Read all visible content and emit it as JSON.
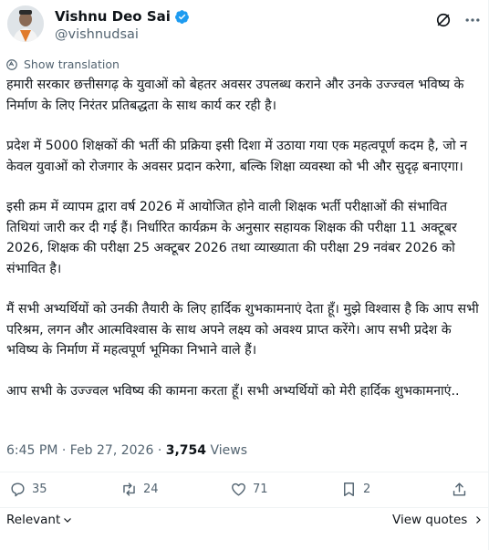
{
  "author": {
    "display_name": "Vishnu Deo Sai",
    "handle": "@vishnudsai",
    "verified_icon": "verified-badge-icon",
    "colors": {
      "verified": "#1d9bf0"
    }
  },
  "translation": {
    "label": "Show translation"
  },
  "post": {
    "paragraphs": [
      "हमारी सरकार छत्तीसगढ़ के युवाओं को बेहतर अवसर उपलब्ध कराने और उनके उज्ज्वल भविष्य के निर्माण के लिए निरंतर प्रतिबद्धता के साथ कार्य कर रही है।",
      "प्रदेश में 5000 शिक्षकों की भर्ती की प्रक्रिया इसी दिशा में उठाया गया एक महत्वपूर्ण कदम है, जो न केवल युवाओं को रोजगार के अवसर प्रदान करेगा, बल्कि शिक्षा व्यवस्था को भी और सुदृढ़ बनाएगा।",
      "इसी क्रम में व्यापम द्वारा वर्ष 2026 में आयोजित होने वाली शिक्षक भर्ती परीक्षाओं की संभावित तिथियां जारी कर दी गई हैं। निर्धारित कार्यक्रम के अनुसार सहायक शिक्षक की परीक्षा 11 अक्टूबर 2026, शिक्षक की परीक्षा 25 अक्टूबर 2026 तथा व्याख्याता की परीक्षा 29 नवंबर 2026 को संभावित है।",
      "मैं सभी अभ्यर्थियों को उनकी तैयारी के लिए हार्दिक शुभकामनाएं देता हूँ। मुझे विश्वास है कि आप सभी परिश्रम, लगन और आत्मविश्वास के साथ अपने लक्ष्य को अवश्य प्राप्त करेंगे। आप सभी प्रदेश के भविष्य के निर्माण में महत्वपूर्ण भूमिका निभाने वाले हैं।",
      "आप सभी के उज्ज्वल भविष्य की कामना करता हूँ। सभी अभ्यर्थियों को मेरी हार्दिक शुभकामनाएं.."
    ]
  },
  "meta": {
    "time": "6:45 PM",
    "separator": " · ",
    "date": "Feb 27, 2026",
    "views_count": "3,754",
    "views_label": " Views"
  },
  "actions": {
    "replies": "35",
    "reposts": "24",
    "likes": "71",
    "bookmarks": "2"
  },
  "footer": {
    "sort_label": "Relevant",
    "quotes_label": "View quotes"
  }
}
